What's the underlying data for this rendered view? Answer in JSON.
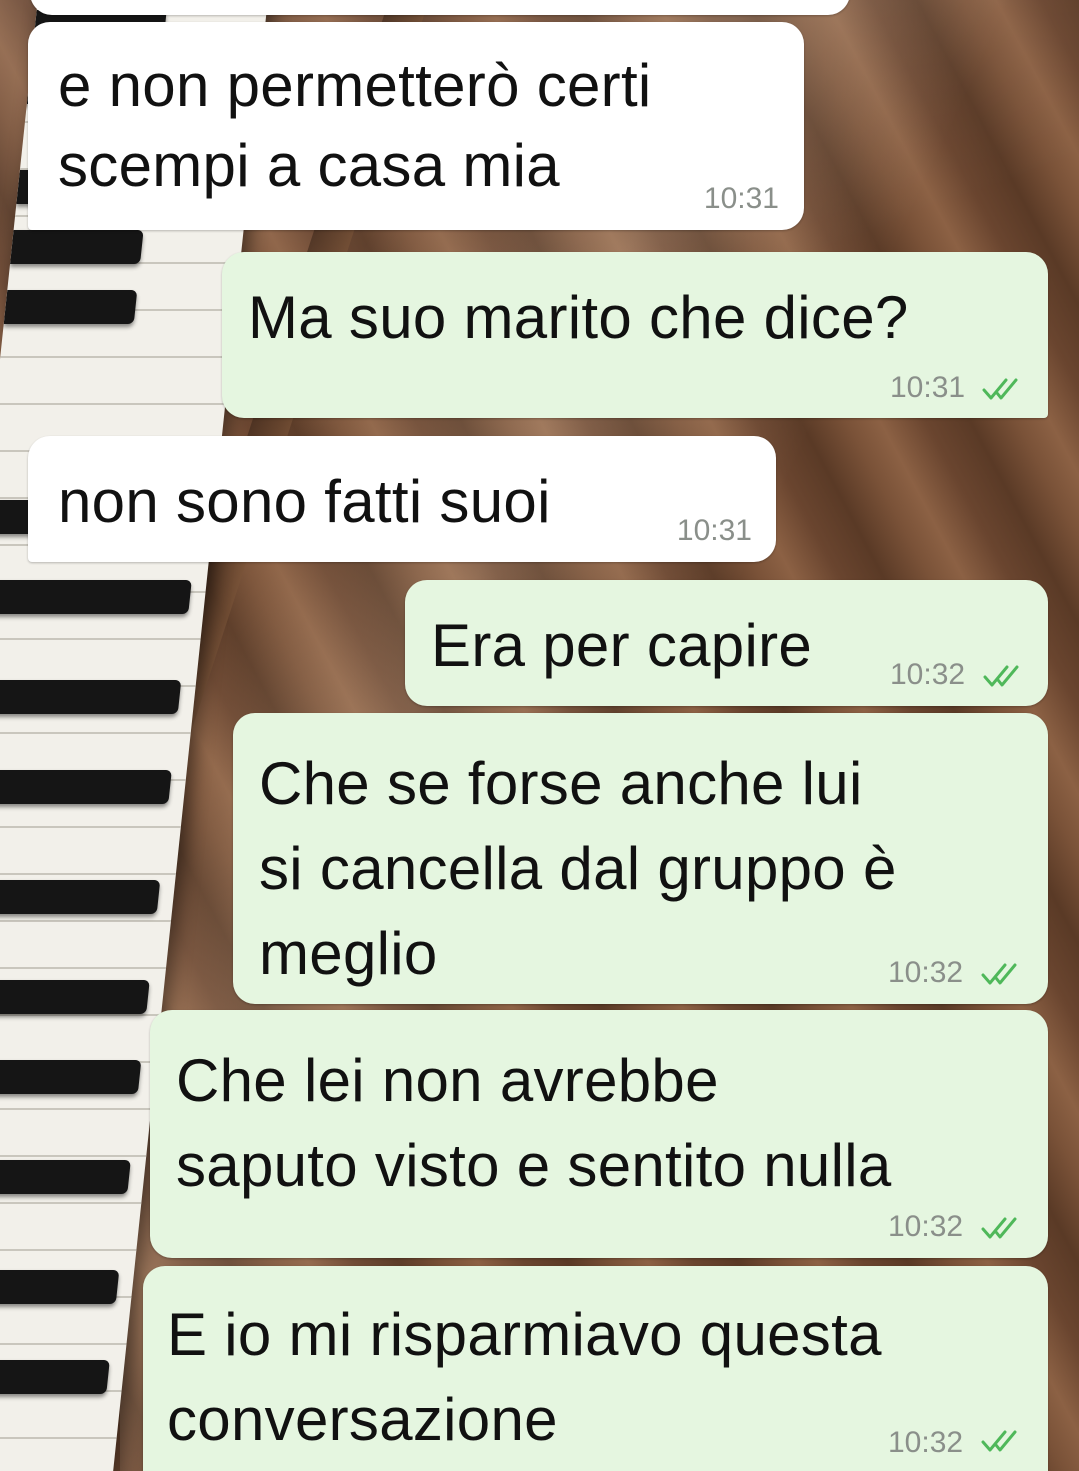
{
  "messages": [
    {
      "direction": "incoming",
      "text": "e non permetterò certi\nscempi a casa mia",
      "time": "10:31"
    },
    {
      "direction": "outgoing",
      "text": "Ma suo marito che dice?",
      "time": "10:31",
      "status": "read"
    },
    {
      "direction": "incoming",
      "text": "non sono fatti suoi",
      "time": "10:31"
    },
    {
      "direction": "outgoing",
      "text": "Era per capire",
      "time": "10:32",
      "status": "read"
    },
    {
      "direction": "outgoing",
      "text": "Che se forse anche lui\nsi cancella dal gruppo è\nmeglio",
      "time": "10:32",
      "status": "read"
    },
    {
      "direction": "outgoing",
      "text": "Che lei non avrebbe\nsaputo visto e sentito nulla",
      "time": "10:32",
      "status": "read"
    },
    {
      "direction": "outgoing",
      "text": "E io mi risparmiavo questa\nconversazione",
      "time": "10:32",
      "status": "read"
    }
  ],
  "colors": {
    "incoming_bubble": "#ffffff",
    "outgoing_bubble": "#e5f6e0",
    "read_ticks": "#4fb85a",
    "timestamp": "#8a8f8a"
  },
  "icons": {
    "read_status": "double-check-icon"
  }
}
